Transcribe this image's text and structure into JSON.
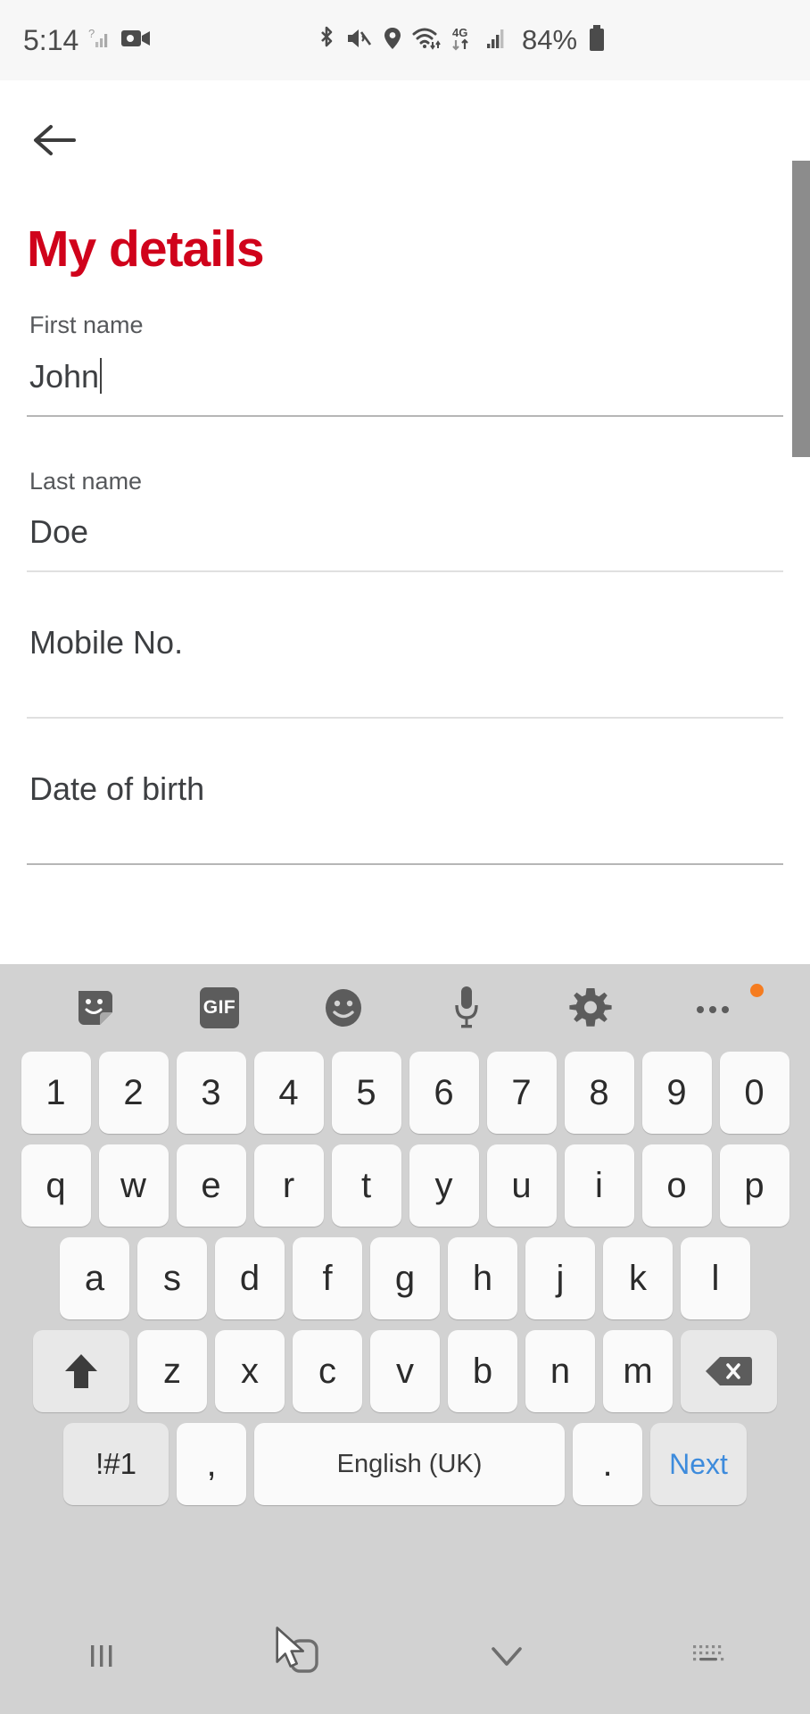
{
  "status_bar": {
    "time": "5:14",
    "battery_percent": "84%",
    "left_icons": [
      "signal-unknown-icon",
      "video-camera-icon"
    ],
    "right_icons": [
      "bluetooth-icon",
      "volume-mute-icon",
      "location-pin-icon",
      "wifi-icon",
      "4g-data-icon",
      "cellular-signal-icon"
    ],
    "network_label": "4G"
  },
  "app": {
    "back_label": "back-arrow",
    "title": "My details",
    "fields": [
      {
        "label": "First name",
        "value": "John",
        "focused": true,
        "empty": false
      },
      {
        "label": "Last name",
        "value": "Doe",
        "focused": false,
        "empty": false
      },
      {
        "label": "",
        "value": "Mobile No.",
        "focused": false,
        "empty": true
      },
      {
        "label": "",
        "value": "Date of birth",
        "focused": false,
        "empty": true
      }
    ]
  },
  "keyboard": {
    "toolbar": [
      {
        "name": "sticker-icon",
        "label": ""
      },
      {
        "name": "gif-icon",
        "label": "GIF"
      },
      {
        "name": "emoji-icon",
        "label": ""
      },
      {
        "name": "microphone-icon",
        "label": ""
      },
      {
        "name": "settings-gear-icon",
        "label": ""
      },
      {
        "name": "more-options-icon",
        "label": ""
      }
    ],
    "rows": {
      "numbers": [
        "1",
        "2",
        "3",
        "4",
        "5",
        "6",
        "7",
        "8",
        "9",
        "0"
      ],
      "qwerty": [
        "q",
        "w",
        "e",
        "r",
        "t",
        "y",
        "u",
        "i",
        "o",
        "p"
      ],
      "asdf": [
        "a",
        "s",
        "d",
        "f",
        "g",
        "h",
        "j",
        "k",
        "l"
      ],
      "zxcv": [
        "z",
        "x",
        "c",
        "v",
        "b",
        "n",
        "m"
      ]
    },
    "shift_label": "shift-icon",
    "backspace_label": "backspace-icon",
    "symbols_key": "!#1",
    "comma_key": ",",
    "space_label": "English (UK)",
    "period_key": ".",
    "next_key": "Next",
    "next_color": "#3d8bdc"
  },
  "navbar": {
    "items": [
      {
        "name": "recents-icon"
      },
      {
        "name": "home-icon"
      },
      {
        "name": "back-chevron-icon"
      },
      {
        "name": "hide-keyboard-icon"
      }
    ]
  },
  "colors": {
    "brand_red": "#d0021b",
    "keyboard_bg": "#d2d2d2",
    "key_bg": "#fafafa",
    "accent_blue": "#3d8bdc",
    "badge_orange": "#f57c20"
  }
}
